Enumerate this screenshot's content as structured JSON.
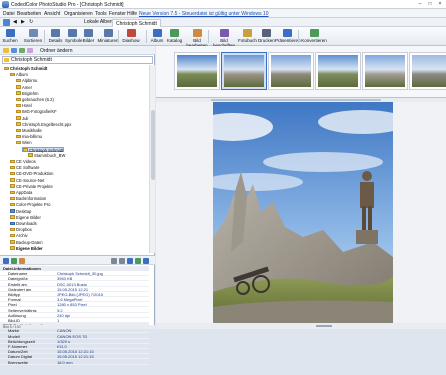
{
  "window": {
    "title": "CodedColor PhotoStudio Pro - [Christoph Schmidt]"
  },
  "menu": {
    "items": [
      "Datei",
      "Bearbeiten",
      "Ansicht",
      "Organisieren",
      "Tools",
      "Fenster",
      "Hilfe"
    ],
    "update_link": "Neue Version 7.5 - Steuerdatei ist gültig unter Windows 10"
  },
  "navbar": {
    "dropdown": "Lokale Alben",
    "active_tab": "Christoph Schmidt"
  },
  "toolbar": {
    "buttons": [
      "Suchen",
      "Sortieren",
      "Details",
      "Symbole",
      "Bilder",
      "Miniaturen",
      "Diashow",
      "Album",
      "Katalog",
      "Bild bearbeiten",
      "Bild beschriften",
      "Fotobuch",
      "Drucken",
      "Präsentieren",
      "Konvertieren"
    ]
  },
  "left_panel": {
    "view_label": "Ordner ändern",
    "path": "Christoph Schmidt",
    "tree": [
      {
        "label": "Christoph Schmidt",
        "indent": 0,
        "style": "bold"
      },
      {
        "label": "Album",
        "indent": 1
      },
      {
        "label": "Alpbirnu",
        "indent": 2
      },
      {
        "label": "Amer",
        "indent": 2
      },
      {
        "label": "Briglehm",
        "indent": 2
      },
      {
        "label": "gebrauchen (6.2)",
        "indent": 2
      },
      {
        "label": "Hotel",
        "indent": 2
      },
      {
        "label": "IMG-Fotografie/KF",
        "indent": 2
      },
      {
        "label": "Juli",
        "indent": 2
      },
      {
        "label": "Christoph.Engelbrecht.ppx",
        "indent": 2
      },
      {
        "label": "Musikhalle",
        "indent": 2
      },
      {
        "label": "mia-billimu",
        "indent": 2
      },
      {
        "label": "Wien",
        "indent": 2
      },
      {
        "label": "Christoph Schmidt",
        "indent": 3,
        "style": "selected"
      },
      {
        "label": "Stammbuch_BW",
        "indent": 4
      },
      {
        "label": "CE Videos",
        "indent": 1
      },
      {
        "label": "CE Software",
        "indent": 1
      },
      {
        "label": "CE-DVD-Produktion",
        "indent": 1
      },
      {
        "label": "CE-Source-Net",
        "indent": 1
      },
      {
        "label": "CE-Private Projekte",
        "indent": 1
      },
      {
        "label": "AppData",
        "indent": 1
      },
      {
        "label": "BackInformation",
        "indent": 1
      },
      {
        "label": "Color-Projekte Pro",
        "indent": 1
      },
      {
        "label": "Desktop",
        "indent": 1,
        "style": "blue"
      },
      {
        "label": "Eigene Bilder",
        "indent": 1
      },
      {
        "label": "Downloads",
        "indent": 1,
        "style": "blue"
      },
      {
        "label": "Dropbox",
        "indent": 1
      },
      {
        "label": "Archiv",
        "indent": 1
      },
      {
        "label": "Backup-Daten",
        "indent": 1
      },
      {
        "label": "Eigene Bilder",
        "indent": 1,
        "style": "bold"
      }
    ]
  },
  "info_panel": {
    "sections": [
      {
        "title": "Datei-Informationen",
        "rows": [
          {
            "key": "Dateiname",
            "value": "Christoph Schmidt_30.jpg"
          },
          {
            "key": "Dateigröße",
            "value": "3953 KB"
          },
          {
            "key": "Erstellt am",
            "value": "DSC-0013.Busto"
          },
          {
            "key": "Geändert am",
            "value": "15.05.2015 12:21"
          },
          {
            "key": "Bildtyp",
            "value": "JPEG-Bild (JPEG) 7/2015"
          },
          {
            "key": "Format",
            "value": "3.6 MegaPixel"
          },
          {
            "key": "Pixel",
            "value": "1280 x 853 Pixel"
          },
          {
            "key": "Seitenverhältnis",
            "value": "3:2"
          },
          {
            "key": "Auflösung",
            "value": "240 dpi"
          },
          {
            "key": "Bild-ID",
            "value": "1"
          }
        ]
      },
      {
        "title": "EXIF Geräteinformationen",
        "rows": [
          {
            "key": "Marke",
            "value": "CANON"
          },
          {
            "key": "Modell",
            "value": "CANON EOS 7D"
          },
          {
            "key": "Belichtungszeit",
            "value": "1/320 s"
          },
          {
            "key": "F-Nummer",
            "value": "f/11.0"
          },
          {
            "key": "Datum/Zeit",
            "value": "15.05.2015 12:21:15"
          },
          {
            "key": "Datum Digital",
            "value": "15.05.2015 12:21:15"
          },
          {
            "key": "Brennweite",
            "value": "18.0 mm"
          }
        ]
      }
    ]
  },
  "filmstrip": {
    "selected_index": 1
  },
  "status": {
    "text": "Bild 6 / 130"
  },
  "colors": {
    "accent": "#3b6fc2",
    "selection": "#cfe0f7",
    "folder": "#e6bf45"
  }
}
